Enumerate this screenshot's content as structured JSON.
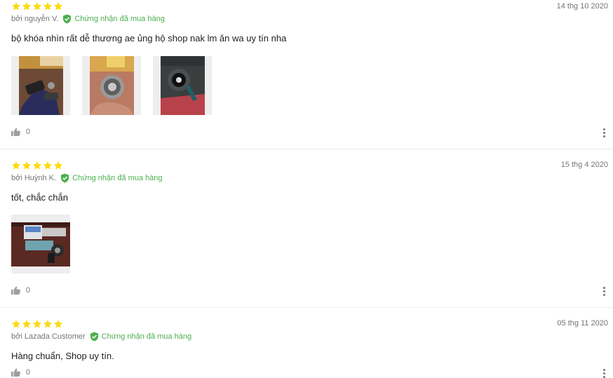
{
  "colors": {
    "star": "#fadb14",
    "verified": "#4caf50",
    "muted": "#757575",
    "text": "#212121",
    "divider": "#eeeeee"
  },
  "reviews": [
    {
      "rating": 5,
      "date": "14 thg 10 2020",
      "author": "bởi nguyễn V.",
      "verified_label": "Chứng nhận đã mua hàng",
      "content": "bộ khóa nhìn rất dễ thương ae ủng hộ shop nak lm ăn wa uy tín nha",
      "likes": "0"
    },
    {
      "rating": 5,
      "date": "15 thg 4 2020",
      "author": "bởi Huỳnh K.",
      "verified_label": "Chứng nhận đã mua hàng",
      "content": "tốt, chắc chắn",
      "likes": "0"
    },
    {
      "rating": 5,
      "date": "05 thg 11 2020",
      "author": "bởi Lazada Customer",
      "verified_label": "Chứng nhận đã mua hàng",
      "content": "Hàng chuẩn, Shop uy tín.",
      "likes": "0"
    }
  ]
}
